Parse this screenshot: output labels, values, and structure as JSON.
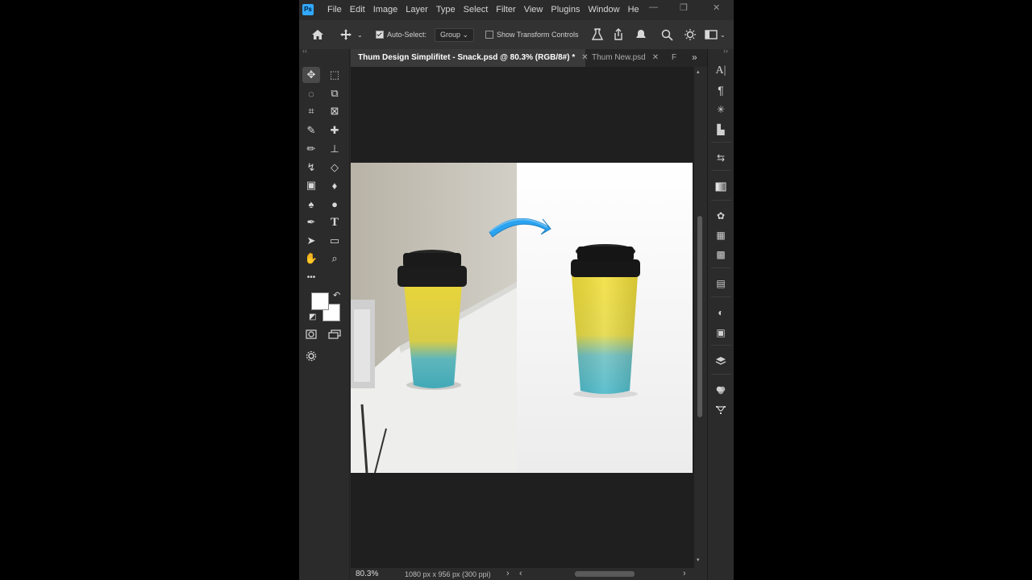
{
  "app": {
    "logo": "Ps",
    "menu": [
      "File",
      "Edit",
      "Image",
      "Layer",
      "Type",
      "Select",
      "Filter",
      "View",
      "Plugins",
      "Window",
      "He"
    ],
    "window_controls": {
      "minimize": "—",
      "maximize": "❐",
      "close": "✕"
    }
  },
  "options_bar": {
    "auto_select_label": "Auto-Select:",
    "auto_select_checked": true,
    "auto_select_target": "Group",
    "show_transform_label": "Show Transform Controls",
    "show_transform_checked": false
  },
  "tabs": [
    {
      "label": "Thum Design Simplifitet - Snack.psd @ 80.3% (RGB/8#) *",
      "close": "✕",
      "active": true
    },
    {
      "label": "Thum New.psd",
      "close": "✕",
      "active": false
    },
    {
      "label": "F",
      "active": false
    }
  ],
  "tabs_more": "»",
  "toolbar": {
    "tools": [
      {
        "name": "move-tool",
        "glyph": "✥"
      },
      {
        "name": "marquee-tool",
        "glyph": "⬚"
      },
      {
        "name": "lasso-tool",
        "glyph": "◌"
      },
      {
        "name": "object-select-tool",
        "glyph": "⧉"
      },
      {
        "name": "crop-tool",
        "glyph": "⌗"
      },
      {
        "name": "frame-tool",
        "glyph": "⊠"
      },
      {
        "name": "eyedropper-tool",
        "glyph": "✎"
      },
      {
        "name": "healing-brush-tool",
        "glyph": "✚"
      },
      {
        "name": "brush-tool",
        "glyph": "✏"
      },
      {
        "name": "clone-stamp-tool",
        "glyph": "⊥"
      },
      {
        "name": "history-brush-tool",
        "glyph": "↯"
      },
      {
        "name": "eraser-tool",
        "glyph": "◇"
      },
      {
        "name": "gradient-tool",
        "glyph": "▣"
      },
      {
        "name": "blur-tool",
        "glyph": "♦"
      },
      {
        "name": "dodge-tool",
        "glyph": "♠"
      },
      {
        "name": "burn-tool",
        "glyph": "●"
      },
      {
        "name": "pen-tool",
        "glyph": "✒"
      },
      {
        "name": "type-tool",
        "glyph": "T"
      },
      {
        "name": "path-selection-tool",
        "glyph": "➤"
      },
      {
        "name": "rectangle-tool",
        "glyph": "▭"
      },
      {
        "name": "hand-tool",
        "glyph": "✋"
      },
      {
        "name": "zoom-tool",
        "glyph": "⌕"
      },
      {
        "name": "more-tools",
        "glyph": "•••"
      }
    ],
    "swap_glyph": "↶",
    "default_colors_glyph": "◩"
  },
  "canvas": {
    "arrow_color": "#2aa3f0",
    "cup_colors": {
      "yellow": "#f2df3a",
      "teal": "#49b8c8",
      "lid": "#151515"
    }
  },
  "status": {
    "zoom": "80.3%",
    "doc_info": "1080 px x 956 px (300 ppi)",
    "nav_right": "›",
    "nav_left": "‹",
    "nav_end": "›"
  },
  "right_panel": [
    "character-icon",
    "paragraph-icon",
    "ai-magic-icon",
    "plugins-icon",
    "history-icon",
    "gradients-icon",
    "color-icon",
    "swatches-icon",
    "patterns-icon",
    "libraries-icon",
    "adjustments-icon",
    "properties-icon",
    "layers-icon",
    "channels-icon",
    "paths-icon"
  ]
}
